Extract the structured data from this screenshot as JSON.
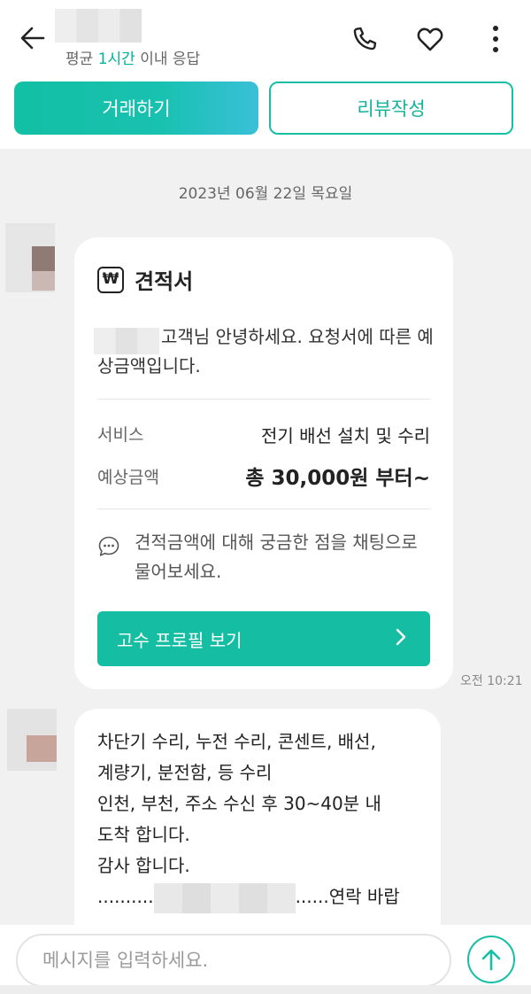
{
  "header": {
    "response_prefix": "평균 ",
    "response_highlight": "1시간",
    "response_suffix": " 이내 응답",
    "deal_button": "거래하기",
    "review_button": "리뷰작성",
    "icons": [
      "back-arrow-icon",
      "phone-icon",
      "heart-icon",
      "more-vertical-icon"
    ]
  },
  "chat": {
    "date": "2023년 06월 22일 목요일",
    "quote_card": {
      "icon": "won-icon",
      "icon_glyph": "₩",
      "title": "견적서",
      "greeting": "고객님 안녕하세요. 요청서에 따른 예상금액입니다.",
      "service_label": "서비스",
      "service_value": "전기 배선 설치 및 수리",
      "price_label": "예상금액",
      "price_value": "총 30,000원 부터~",
      "inquiry": "견적금액에 대해 궁금한 점을 채팅으로 물어보세요.",
      "profile_button": "고수 프로필 보기",
      "profile_chevron": "›"
    },
    "time": "오전 10:21",
    "message": {
      "line1": "차단기 수리, 누전 수리, 콘센트, 배선,",
      "line2": "계량기, 분전함, 등 수리",
      "line3": "인천, 부천, 주소 수신 후 30~40분 내",
      "line4": "도착 합니다.",
      "line5": "감사 합니다.",
      "line6_prefix": "..........",
      "line6_suffix": "......연락 바랍"
    }
  },
  "input": {
    "placeholder": "메시지를 입력하세요."
  },
  "colors": {
    "accent": "#16bfa5",
    "background": "#f1f1f1"
  }
}
